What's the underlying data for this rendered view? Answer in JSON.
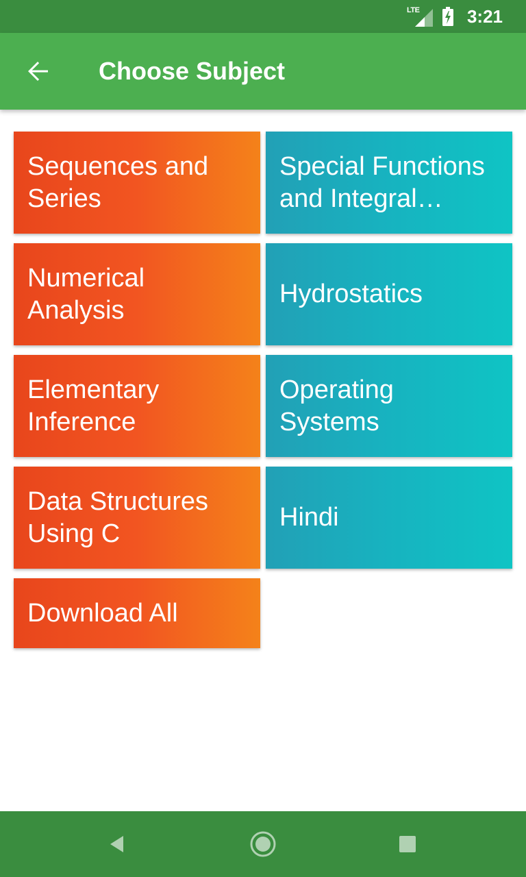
{
  "status_bar": {
    "network": "LTE",
    "time": "3:21",
    "icons": [
      "lte-signal-icon",
      "battery-charging-icon"
    ]
  },
  "app_bar": {
    "title": "Choose Subject",
    "back_icon": "arrow-back-icon"
  },
  "tiles": [
    {
      "label": "Sequences and Series"
    },
    {
      "label": "Special Functions and Integral Transforms"
    },
    {
      "label": "Numerical Analysis"
    },
    {
      "label": "Hydrostatics"
    },
    {
      "label": "Elementary Inference"
    },
    {
      "label": "Operating Systems"
    },
    {
      "label": "Data Structures Using C"
    },
    {
      "label": "Hindi"
    },
    {
      "label": "Download All"
    }
  ],
  "colors": {
    "status_bar": "#3a8d3f",
    "app_bar": "#4caf50",
    "tile_orange_start": "#e8461c",
    "tile_orange_end": "#f4821a",
    "tile_teal_start": "#22a0b6",
    "tile_teal_end": "#0fc4c4"
  },
  "nav_bar": {
    "icons": [
      "nav-back-icon",
      "nav-home-icon",
      "nav-recents-icon"
    ]
  }
}
